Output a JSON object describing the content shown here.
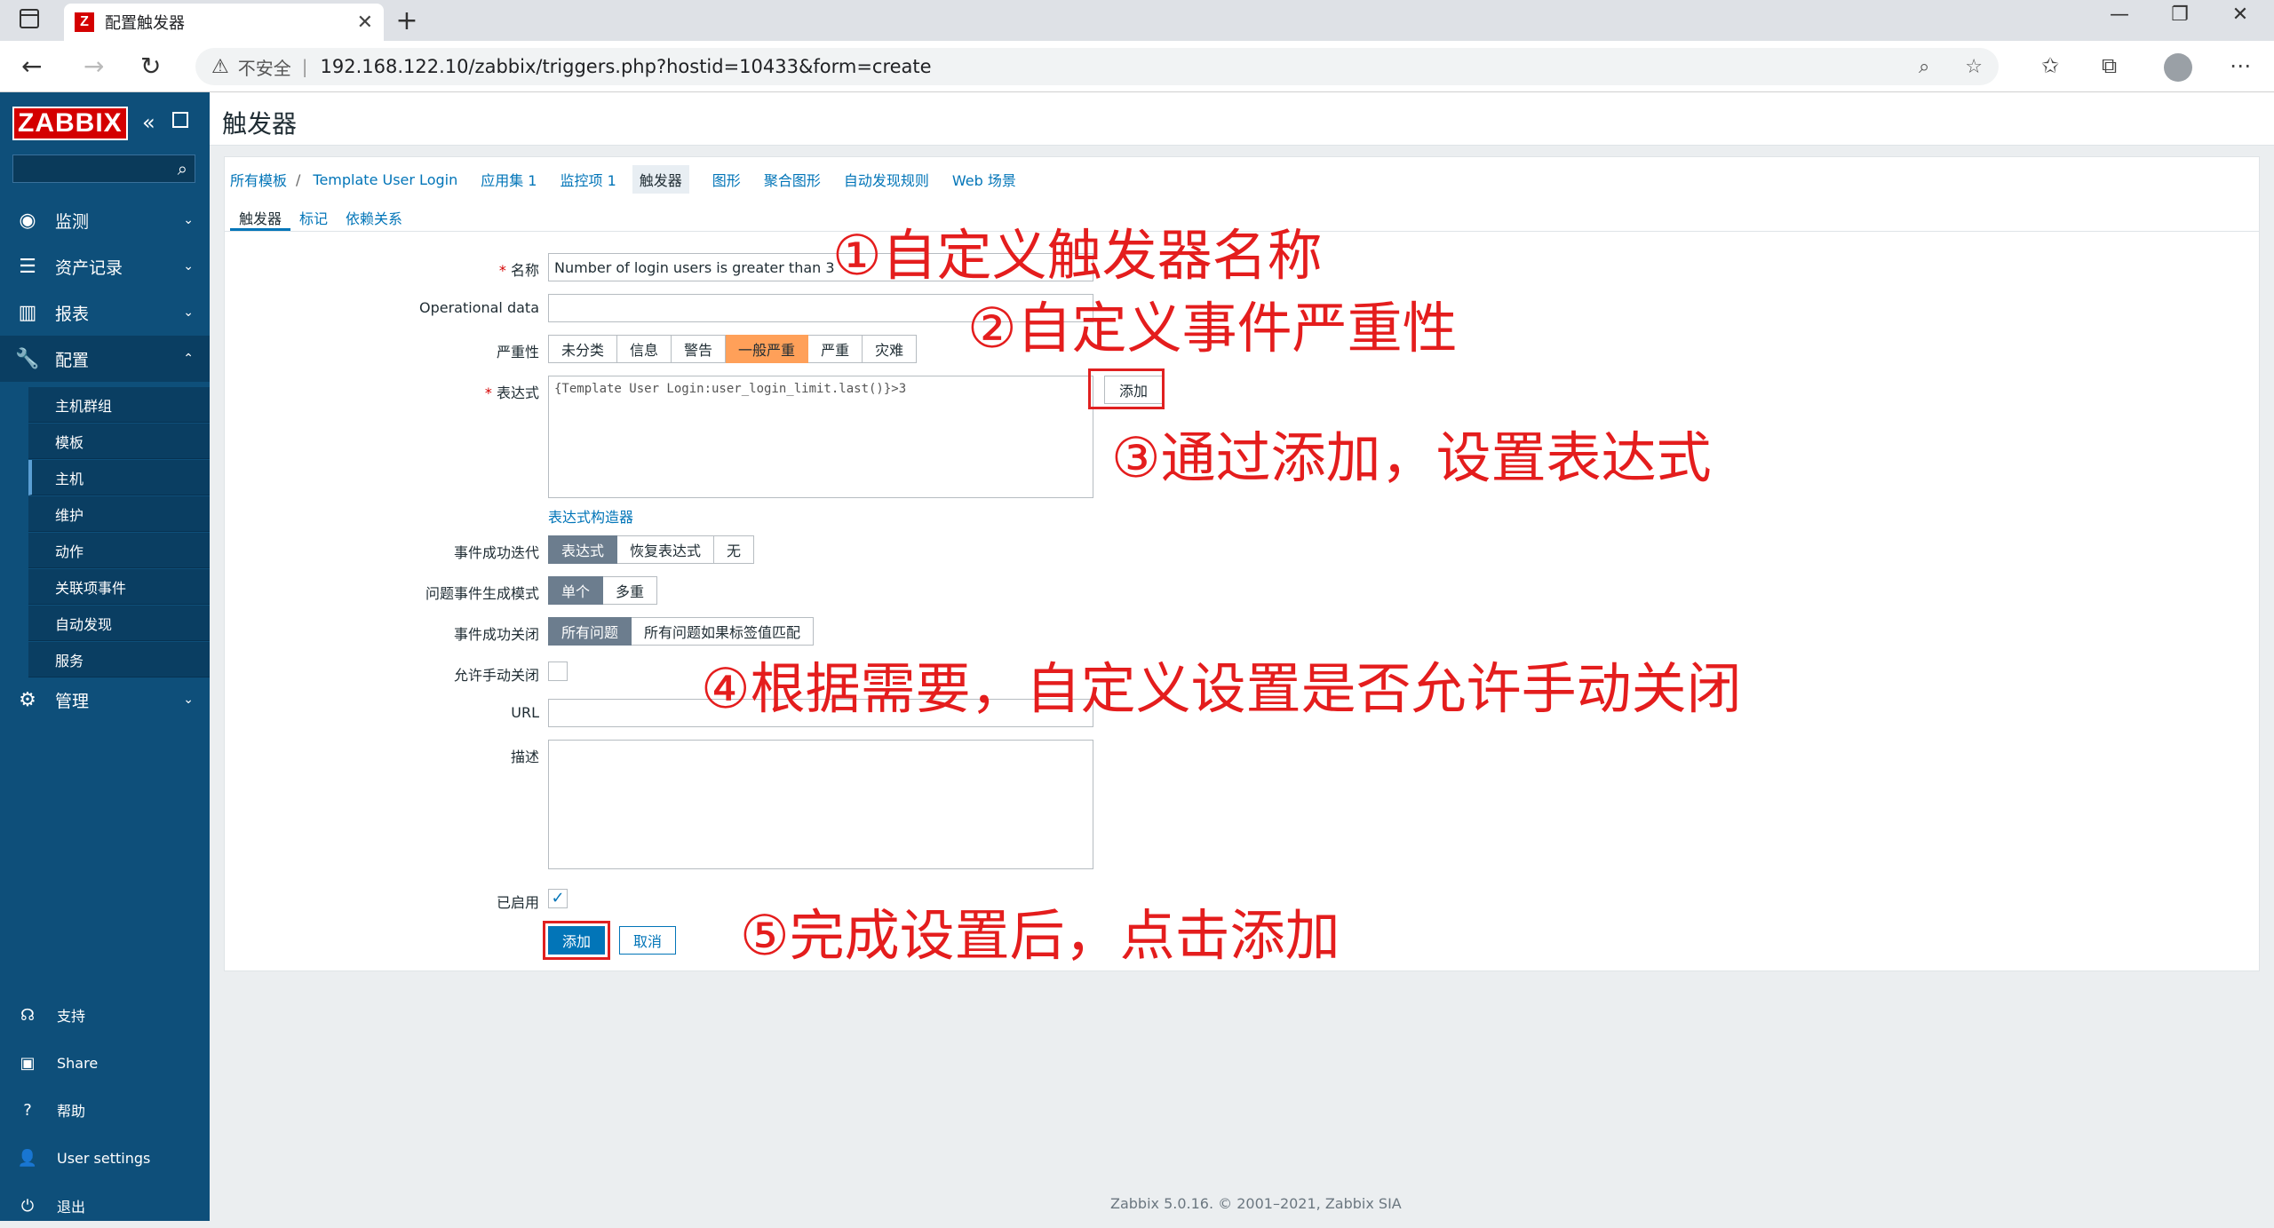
{
  "browser": {
    "tab_title": "配置触发器",
    "favicon_letter": "Z",
    "close": "✕",
    "new_tab": "+",
    "insecure": "不安全",
    "url": "192.168.122.10/zabbix/triggers.php?hostid=10433&form=create"
  },
  "sidebar": {
    "logo": "ZABBIX",
    "menus": [
      {
        "label": "监测",
        "icon": "eye-icon"
      },
      {
        "label": "资产记录",
        "icon": "list-icon"
      },
      {
        "label": "报表",
        "icon": "chart-icon"
      },
      {
        "label": "配置",
        "icon": "wrench-icon"
      },
      {
        "label": "管理",
        "icon": "gear-icon"
      }
    ],
    "sub": [
      "主机群组",
      "模板",
      "主机",
      "维护",
      "动作",
      "关联项事件",
      "自动发现",
      "服务"
    ],
    "footer": [
      "支持",
      "Share",
      "帮助",
      "User settings",
      "退出"
    ]
  },
  "page": {
    "title": "触发器"
  },
  "breadcrumb": {
    "all_templates": "所有模板",
    "template": "Template User Login",
    "apps": "应用集 1",
    "items": "监控项 1",
    "triggers": "触发器",
    "graphs": "图形",
    "screens": "聚合图形",
    "discovery": "自动发现规则",
    "web": "Web 场景"
  },
  "subtabs": [
    "触发器",
    "标记",
    "依赖关系"
  ],
  "form": {
    "name_label": "名称",
    "name_value": "Number of login users is greater than 3",
    "opdata_label": "Operational data",
    "severity_label": "严重性",
    "severities": [
      "未分类",
      "信息",
      "警告",
      "一般严重",
      "严重",
      "灾难"
    ],
    "expr_label": "表达式",
    "expr_value": "{Template User Login:user_login_limit.last()}>3",
    "expr_add": "添加",
    "expr_builder": "表达式构造器",
    "ok_gen_label": "事件成功迭代",
    "ok_gen": [
      "表达式",
      "恢复表达式",
      "无"
    ],
    "problem_mode_label": "问题事件生成模式",
    "problem_mode": [
      "单个",
      "多重"
    ],
    "ok_close_label": "事件成功关闭",
    "ok_close": [
      "所有问题",
      "所有问题如果标签值匹配"
    ],
    "manual_close_label": "允许手动关闭",
    "url_label": "URL",
    "desc_label": "描述",
    "enabled_label": "已启用",
    "submit": "添加",
    "cancel": "取消"
  },
  "notes": {
    "n1": "①自定义触发器名称",
    "n2": "②自定义事件严重性",
    "n3": "③通过添加，设置表达式",
    "n4": "④根据需要，自定义设置是否允许手动关闭",
    "n5": "⑤完成设置后，点击添加"
  },
  "footer": {
    "text": "Zabbix 5.0.16. © 2001–2021,",
    "company": "Zabbix SIA"
  },
  "colors": {
    "sidebar": "#0e4f7a",
    "accent": "#0275b8",
    "severity_average": "#ffa059",
    "annotation": "#e41d1d"
  }
}
